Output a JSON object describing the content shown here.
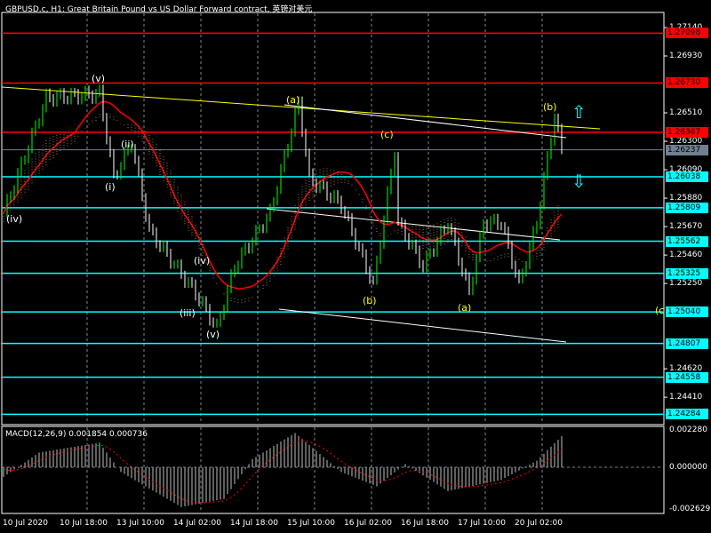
{
  "title": "GBPUSD.c, H1:  Great Britain Pound vs US Dollar Forward contract, 英镑对美元",
  "macd_title": "MACD(12,26,9) 0.001854 0.000736",
  "colors": {
    "red_level": "#ff0000",
    "cyan_level": "#00ffff",
    "current": "#708090",
    "bull": "#00ff00",
    "bear": "#ffffff",
    "ma": "#ff0000",
    "trend": "#ffff00",
    "wave_white": "#ffffff",
    "wave_yellow": "#ffff00"
  },
  "price_ticks": [
    "1.27140",
    "1.26930",
    "1.26510",
    "1.26300",
    "1.26090",
    "1.25880",
    "1.25670",
    "1.25460",
    "1.25250",
    "1.24620",
    "1.24410"
  ],
  "macd_ticks": [
    "0.002280",
    "0.000000",
    "-0.002629"
  ],
  "levels": [
    {
      "price": "1.27098",
      "type": "red"
    },
    {
      "price": "1.26730",
      "type": "red"
    },
    {
      "price": "1.26367",
      "type": "red"
    },
    {
      "price": "1.26038",
      "type": "cyan"
    },
    {
      "price": "1.25809",
      "type": "cyan"
    },
    {
      "price": "1.25562",
      "type": "cyan"
    },
    {
      "price": "1.25325",
      "type": "cyan"
    },
    {
      "price": "1.25040",
      "type": "cyan"
    },
    {
      "price": "1.24807",
      "type": "cyan"
    },
    {
      "price": "1.24558",
      "type": "cyan"
    },
    {
      "price": "1.24284",
      "type": "cyan"
    }
  ],
  "current_price": "1.26237",
  "time_labels": [
    "10 Jul 2020",
    "10 Jul 18:00",
    "13 Jul 10:00",
    "14 Jul 02:00",
    "14 Jul 18:00",
    "15 Jul 10:00",
    "16 Jul 02:00",
    "16 Jul 18:00",
    "17 Jul 10:00",
    "20 Jul 02:00"
  ],
  "wave_labels": [
    "(v)",
    "(iv)",
    "(i)",
    "(ii)",
    "(iv)",
    "(iii)",
    "(v)",
    "(a)",
    "(c)",
    "(b)",
    "(a)",
    "(b)",
    "(c"
  ],
  "chart_data": {
    "type": "candlestick",
    "symbol": "GBPUSD.c",
    "timeframe": "H1",
    "ylim": [
      1.242,
      1.2724
    ],
    "price_anchors": [
      [
        0,
        1.2577
      ],
      [
        12,
        1.2662
      ],
      [
        27,
        1.2665
      ],
      [
        31,
        1.2603
      ],
      [
        36,
        1.2629
      ],
      [
        41,
        1.2564
      ],
      [
        54,
        1.2518
      ],
      [
        60,
        1.2492
      ],
      [
        65,
        1.2538
      ],
      [
        75,
        1.2577
      ],
      [
        83,
        1.2659
      ],
      [
        86,
        1.2603
      ],
      [
        95,
        1.2583
      ],
      [
        104,
        1.2524
      ],
      [
        110,
        1.2623
      ],
      [
        111,
        1.257
      ],
      [
        118,
        1.2538
      ],
      [
        125,
        1.257
      ],
      [
        131,
        1.2518
      ],
      [
        135,
        1.257
      ],
      [
        140,
        1.257
      ],
      [
        145,
        1.2524
      ],
      [
        150,
        1.257
      ],
      [
        155,
        1.2649
      ],
      [
        157,
        1.2623
      ]
    ],
    "macd": {
      "ylim": [
        -0.002629,
        0.00228
      ],
      "hist_anchors": [
        [
          0,
          -0.0006
        ],
        [
          10,
          0.0009
        ],
        [
          27,
          0.0015
        ],
        [
          33,
          -0.0003
        ],
        [
          50,
          -0.0025
        ],
        [
          62,
          -0.002
        ],
        [
          70,
          0.0005
        ],
        [
          82,
          0.0021
        ],
        [
          95,
          -0.0003
        ],
        [
          105,
          -0.0012
        ],
        [
          113,
          0.0002
        ],
        [
          125,
          -0.0015
        ],
        [
          140,
          -0.0008
        ],
        [
          150,
          0.0004
        ],
        [
          157,
          0.0019
        ]
      ]
    }
  }
}
